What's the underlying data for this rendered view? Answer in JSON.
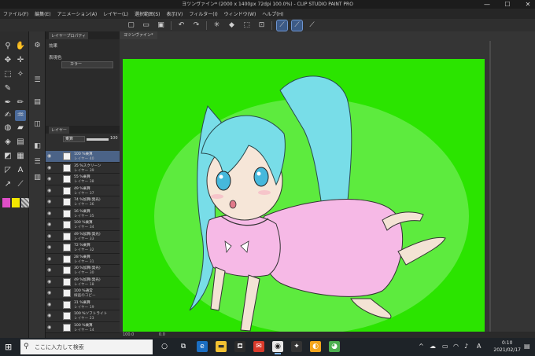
{
  "window": {
    "title": "ヨツンヴァイン* (2000 x 1400px 72dpi 100.0%) - CLIP STUDIO PAINT PRO",
    "controls": [
      "—",
      "☐",
      "✕"
    ]
  },
  "menu": [
    "ファイル(F)",
    "編集(E)",
    "アニメーション(A)",
    "レイヤー(L)",
    "選択範囲(S)",
    "表示(V)",
    "フィルター(I)",
    "ウィンドウ(W)",
    "ヘルプ(H)"
  ],
  "property_panel": {
    "tab": "レイヤープロパティ",
    "effect_label": "効果",
    "expression_color_label": "表現色",
    "expression_color_value": "カラー"
  },
  "layer_panel": {
    "tab": "レイヤー",
    "blend_mode": "乗算",
    "opacity": "100",
    "layers": [
      {
        "line1": "100 %乗算",
        "line2": "レイヤー 40",
        "selected": true
      },
      {
        "line1": "35 %スクリーン",
        "line2": "レイヤー 39",
        "selected": false
      },
      {
        "line1": "55 %乗算",
        "line2": "レイヤー 38",
        "selected": false
      },
      {
        "line1": "49 %乗算",
        "line2": "レイヤー 37",
        "selected": false
      },
      {
        "line1": "74 %加算(発光)",
        "line2": "レイヤー 36",
        "selected": false
      },
      {
        "line1": "16 %乗算",
        "line2": "レイヤー 35",
        "selected": false
      },
      {
        "line1": "100 %乗算",
        "line2": "レイヤー 34",
        "selected": false
      },
      {
        "line1": "49 %加算(発光)",
        "line2": "レイヤー 33",
        "selected": false
      },
      {
        "line1": "72 %乗算",
        "line2": "レイヤー 32",
        "selected": false
      },
      {
        "line1": "28 %乗算",
        "line2": "レイヤー 31",
        "selected": false
      },
      {
        "line1": "30 %加算(発光)",
        "line2": "レイヤー 30",
        "selected": false
      },
      {
        "line1": "49 %加算(発光)",
        "line2": "レイヤー 18",
        "selected": false
      },
      {
        "line1": "100 %通常",
        "line2": "線画のコピー",
        "selected": false
      },
      {
        "line1": "31 %乗算",
        "line2": "レイヤー 19",
        "selected": false
      },
      {
        "line1": "100 %ソフトライト",
        "line2": "レイヤー 23",
        "selected": false
      },
      {
        "line1": "100 %乗算",
        "line2": "レイヤー 14",
        "selected": false
      }
    ]
  },
  "canvas": {
    "tab": "ヨツンヴァイン*",
    "background_color": "#2be400",
    "zoom": "100.0",
    "rotation": "0.0"
  },
  "taskbar": {
    "search_placeholder": "ここに入力して検索",
    "ime": "A",
    "time": "0:10",
    "date": "2021/02/17"
  },
  "icons": {
    "tools": [
      "magnifier-icon",
      "hand-icon",
      "move-icon",
      "selection-icon",
      "eyedropper-icon",
      "pen-icon",
      "pencil-icon",
      "brush-icon",
      "airbrush-icon",
      "eraser-icon",
      "fill-icon",
      "gradient-icon",
      "figure-icon",
      "text-icon",
      "frame-icon",
      "ruler-icon"
    ]
  },
  "colors": {
    "main_color": "#e04fc8",
    "sub_color": "#f2e600",
    "accent": "#4b6387"
  }
}
